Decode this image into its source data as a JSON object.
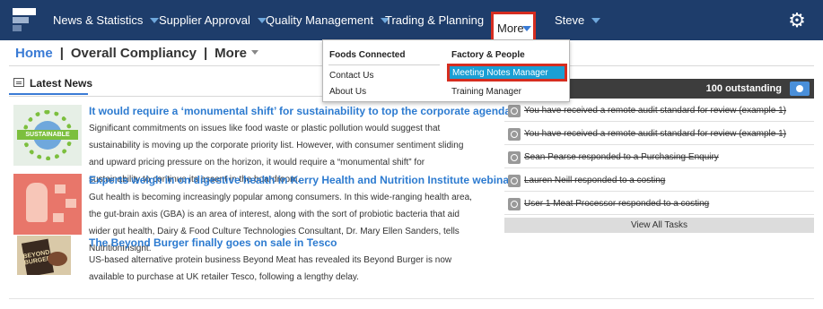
{
  "nav": {
    "items": [
      {
        "label": "News & Statistics"
      },
      {
        "label": "Supplier Approval"
      },
      {
        "label": "Quality Management"
      },
      {
        "label": "Trading & Planning"
      },
      {
        "label": "More"
      },
      {
        "label": "Steve"
      }
    ],
    "accent": "#1e3d6b",
    "highlight": "#d62d20"
  },
  "breadcrumb": {
    "home": "Home",
    "section": "Overall Compliancy",
    "more": "More"
  },
  "news": {
    "tab_label": "Latest News",
    "articles": [
      {
        "title": "It would require a ‘monumental shift’ for sustainability to top the corporate agenda",
        "body": "Significant commitments on issues like food waste or plastic pollution would suggest that sustainability is moving up the corporate priority list. However, with consumer sentiment sliding and upward pricing pressure on the horizon, it would require a “monumental shift” for sustainability to continue its assent in the boardroom.",
        "thumb_text": "SUSTAINABLE"
      },
      {
        "title": "Experts weigh in on digestive health in Kerry Health and Nutrition Institute webinar",
        "body": "Gut health is becoming increasingly popular among consumers. In this wide-ranging health area, the gut-brain axis (GBA) is an area of interest, along with the sort of probiotic bacteria that aid wider gut health, Dairy & Food Culture Technologies Consultant, Dr. Mary Ellen Sanders, tells NutritionInsight."
      },
      {
        "title": "The Beyond Burger finally goes on sale in Tesco",
        "body": "US-based alternative protein business Beyond Meat has revealed its Beyond Burger is now available to purchase at UK retailer Tesco, following a lengthy delay.",
        "thumb_text": "BEYOND BURGER"
      }
    ]
  },
  "tasks": {
    "outstanding": "100 outstanding",
    "items": [
      {
        "text": "You have received a remote audit standard for review (example 1)"
      },
      {
        "text": "You have received a remote audit standard for review (example 1)"
      },
      {
        "text": "Sean Pearse responded to a Purchasing Enquiry"
      },
      {
        "text": "Lauren Neill responded to a costing"
      },
      {
        "text": "User 1 Meat Processor responded to a costing"
      }
    ],
    "view_all": "View All Tasks"
  },
  "more_menu": {
    "col1_heading": "Foods Connected",
    "col1_items": [
      "Contact Us",
      "About Us"
    ],
    "col2_heading": "Factory & People",
    "col2_items": [
      "Meeting Notes Manager",
      "Training Manager"
    ],
    "highlight_color": "#1a9fd4"
  }
}
